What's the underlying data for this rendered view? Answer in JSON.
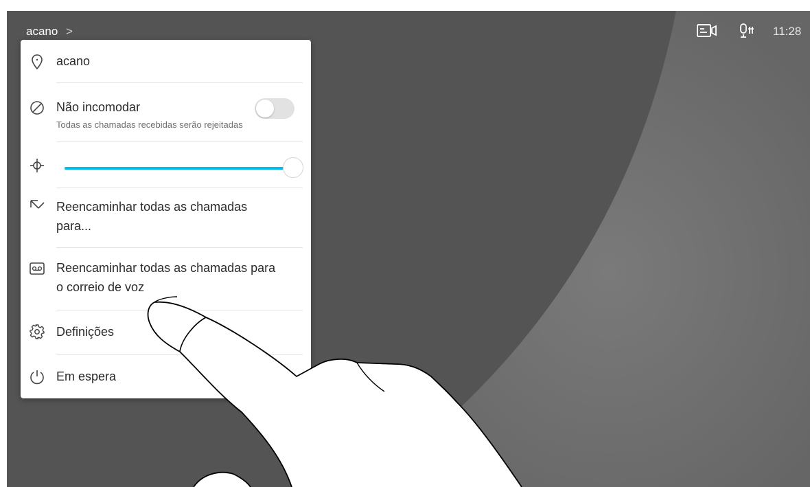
{
  "header": {
    "device_name": "acano",
    "chevron": ">",
    "time": "11:28",
    "icons": [
      "self-view-icon",
      "mic-mute-icon"
    ]
  },
  "menu": {
    "location": {
      "label": "acano",
      "icon": "location-pin-icon"
    },
    "do_not_disturb": {
      "label": "Não incomodar",
      "sublabel": "Todas as chamadas recebidas serão rejeitadas",
      "icon": "do-not-disturb-icon",
      "enabled": false
    },
    "brightness": {
      "icon": "brightness-icon",
      "level": 1.0
    },
    "forward_all": {
      "label_line1": "Reencaminhar todas as chamadas",
      "label_line2": "para...",
      "icon": "call-forward-icon"
    },
    "forward_voicemail": {
      "label_line1": "Reencaminhar todas as chamadas para",
      "label_line2": "o correio de voz",
      "icon": "voicemail-icon"
    },
    "settings": {
      "label": "Definições",
      "icon": "gear-icon"
    },
    "standby": {
      "label": "Em espera",
      "icon": "power-icon"
    }
  },
  "colors": {
    "accent": "#00bceb",
    "background": "#545454",
    "panel": "#ffffff"
  }
}
